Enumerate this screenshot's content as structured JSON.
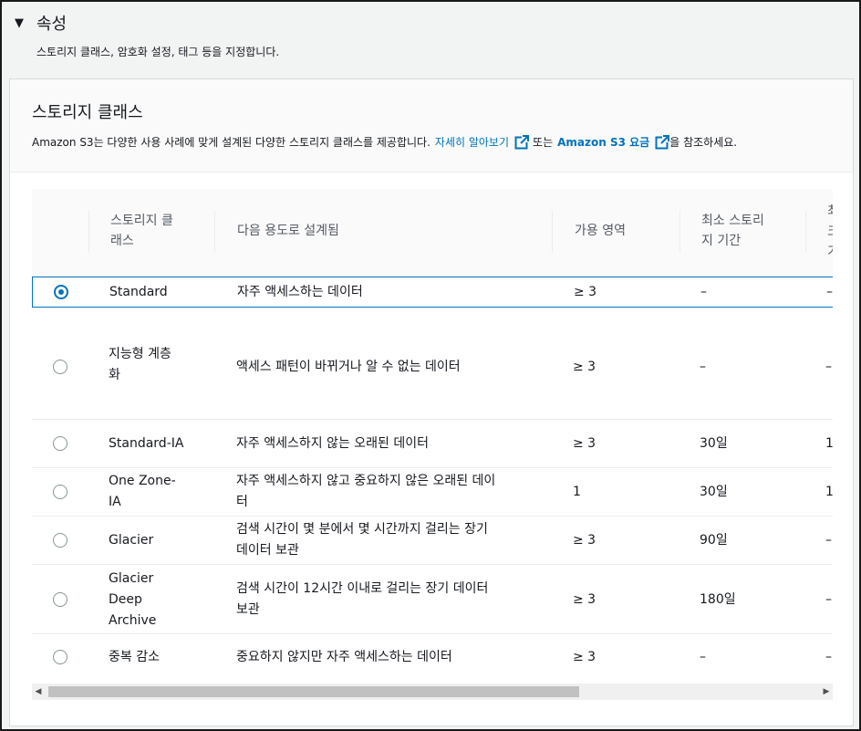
{
  "section": {
    "title": "속성",
    "description": "스토리지 클래스, 암호화 설정, 태그 등을 지정합니다."
  },
  "panel": {
    "title": "스토리지 클래스",
    "desc_prefix": "Amazon S3는 다양한 사용 사례에 맞게 설계된 다양한 스토리지 클래스를 제공합니다.",
    "learn_more_link": "자세히 알아보기",
    "desc_middle": "또는",
    "pricing_link": "Amazon S3 요금",
    "desc_suffix": "을 참조하세요."
  },
  "table": {
    "headers": {
      "storage_class_l1": "스토리지 클",
      "storage_class_l2": "래스",
      "designed_for": "다음 용도로 설계됨",
      "availability_zones": "가용 영역",
      "min_duration_l1": "최소 스토리",
      "min_duration_l2": "지 기간",
      "next_col_l1": "최",
      "next_col_l2": "크",
      "next_col_l3": "기"
    },
    "rows": [
      {
        "name_l1": "Standard",
        "name_l2": "",
        "name_l3": "",
        "use_l1": "자주 액세스하는 데이터",
        "use_l2": "",
        "az": "≥ 3",
        "min": "–",
        "next": "–",
        "selected": true
      },
      {
        "name_l1": "지능형 계층",
        "name_l2": "화",
        "name_l3": "",
        "use_l1": "액세스 패턴이 바뀌거나 알 수 없는 데이터",
        "use_l2": "",
        "az": "≥ 3",
        "min": "–",
        "next": "–",
        "selected": false
      },
      {
        "name_l1": "Standard-IA",
        "name_l2": "",
        "name_l3": "",
        "use_l1": "자주 액세스하지 않는 오래된 데이터",
        "use_l2": "",
        "az": "≥ 3",
        "min": "30일",
        "next": "1",
        "selected": false
      },
      {
        "name_l1": "One Zone-",
        "name_l2": "IA",
        "name_l3": "",
        "use_l1": "자주 액세스하지 않고 중요하지 않은 오래된 데이",
        "use_l2": "터",
        "az": "1",
        "min": "30일",
        "next": "1",
        "selected": false
      },
      {
        "name_l1": "Glacier",
        "name_l2": "",
        "name_l3": "",
        "use_l1": "검색 시간이 몇 분에서 몇 시간까지 걸리는 장기",
        "use_l2": "데이터 보관",
        "az": "≥ 3",
        "min": "90일",
        "next": "–",
        "selected": false
      },
      {
        "name_l1": "Glacier",
        "name_l2": "Deep",
        "name_l3": "Archive",
        "use_l1": "검색 시간이 12시간 이내로 걸리는 장기 데이터",
        "use_l2": "보관",
        "az": "≥ 3",
        "min": "180일",
        "next": "–",
        "selected": false
      },
      {
        "name_l1": "중복 감소",
        "name_l2": "",
        "name_l3": "",
        "use_l1": "중요하지 않지만 자주 액세스하는 데이터",
        "use_l2": "",
        "az": "≥ 3",
        "min": "–",
        "next": "–",
        "selected": false
      }
    ]
  },
  "icons": {
    "caret": "caret-down-icon",
    "external": "external-link-icon",
    "scroll_left": "scroll-left-icon",
    "scroll_right": "scroll-right-icon"
  }
}
